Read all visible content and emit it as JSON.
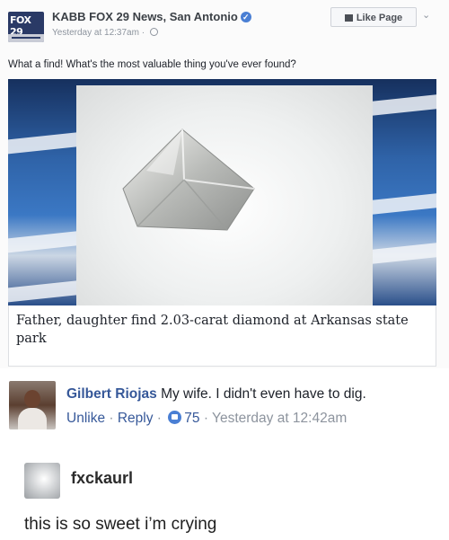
{
  "post": {
    "page_name": "KABB FOX 29 News, San Antonio",
    "logo_text": "FOX 29",
    "timestamp": "Yesterday at 12:37am · ",
    "like_page_label": "Like Page",
    "text": "What a find! What's the most valuable thing you've ever found?",
    "link_title": "Father, daughter find 2.03-carat diamond at Arkansas state park"
  },
  "comment": {
    "author": "Gilbert Riojas",
    "text": " My wife. I didn't even have to dig.",
    "unlike_label": "Unlike",
    "reply_label": "Reply",
    "separator": " · ",
    "likes": "75",
    "time": "Yesterday at 12:42am"
  },
  "tumblr": {
    "username": "fxckaurl",
    "text": "this is so sweet i’m crying"
  },
  "icons": {
    "verified": "verified-badge-icon",
    "globe": "globe-icon",
    "like": "thumbs-up-icon",
    "chevron": "chevron-down-icon"
  },
  "colors": {
    "facebook_link": "#365899",
    "verified_blue": "#4a7fd4",
    "meta_gray": "#8d949e"
  }
}
